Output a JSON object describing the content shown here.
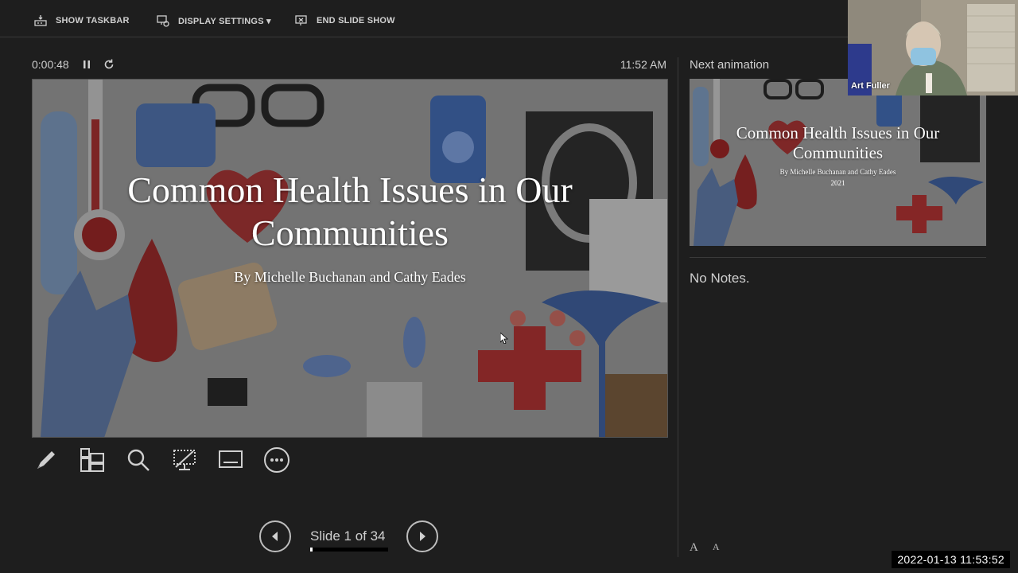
{
  "toolbar": {
    "show_taskbar": "SHOW TASKBAR",
    "display_settings": "DISPLAY SETTINGS ▾",
    "end_slide_show": "END SLIDE SHOW"
  },
  "presenter": {
    "elapsed": "0:00:48",
    "clock": "11:52 AM"
  },
  "slide": {
    "title": "Common Health Issues in Our Communities",
    "subtitle": "By Michelle Buchanan and Cathy Eades"
  },
  "navigation": {
    "counter": "Slide 1 of 34",
    "current": 1,
    "total": 34,
    "progress_fraction": 0.03
  },
  "next_panel": {
    "label": "Next animation",
    "thumb_title": "Common Health Issues in Our Communities",
    "thumb_subtitle": "By Michelle Buchanan and Cathy Eades",
    "thumb_year": "2021"
  },
  "notes": {
    "text": "No Notes."
  },
  "font_controls": {
    "increase": "A",
    "decrease": "A"
  },
  "webcam": {
    "name": "Art Fuller"
  },
  "timestamp": "2022-01-13  11:53:52",
  "icons": [
    "taskbar-icon",
    "display-settings-icon",
    "end-show-icon",
    "pause-icon",
    "restart-icon",
    "pen-icon",
    "see-all-slides-icon",
    "zoom-icon",
    "black-screen-icon",
    "subtitles-icon",
    "more-options-icon",
    "previous-icon",
    "next-icon"
  ]
}
